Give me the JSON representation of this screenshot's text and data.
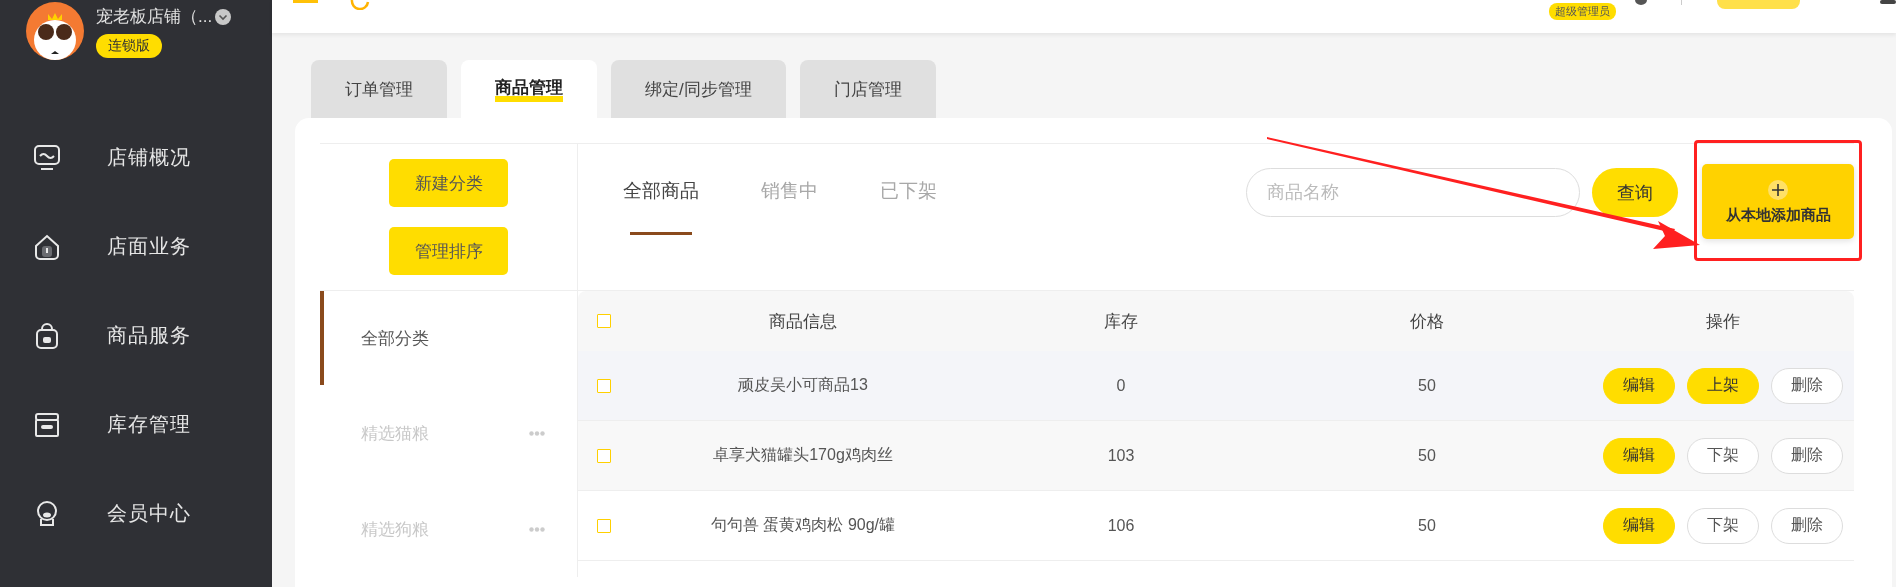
{
  "sidebar": {
    "store_name": "宠老板店铺（...",
    "edition_badge": "连锁版",
    "items": [
      {
        "label": "店铺概况"
      },
      {
        "label": "店面业务"
      },
      {
        "label": "商品服务"
      },
      {
        "label": "库存管理"
      },
      {
        "label": "会员中心"
      }
    ]
  },
  "top_bar": {
    "role_badge": "超级管理员"
  },
  "tabs": [
    {
      "label": "订单管理",
      "selected": false
    },
    {
      "label": "商品管理",
      "selected": true
    },
    {
      "label": "绑定/同步管理",
      "selected": false
    },
    {
      "label": "门店管理",
      "selected": false
    }
  ],
  "categories": {
    "buttons": [
      "新建分类",
      "管理排序"
    ],
    "items": [
      {
        "label": "全部分类",
        "selected": true,
        "has_menu": false
      },
      {
        "label": "精选猫粮",
        "selected": false,
        "has_menu": true
      },
      {
        "label": "精选狗粮",
        "selected": false,
        "has_menu": true
      }
    ]
  },
  "status_tabs": [
    {
      "label": "全部商品",
      "selected": true
    },
    {
      "label": "销售中",
      "selected": false
    },
    {
      "label": "已下架",
      "selected": false
    }
  ],
  "search": {
    "placeholder": "商品名称",
    "button": "查询"
  },
  "add_button": {
    "label": "从本地添加商品"
  },
  "table": {
    "select_all_checked": false,
    "columns": [
      "商品信息",
      "库存",
      "价格",
      "操作"
    ],
    "rows": [
      {
        "checked": false,
        "cells": [
          "顽皮吴小可商品13",
          "0",
          "50"
        ],
        "actions": [
          {
            "label": "编辑",
            "primary": true
          },
          {
            "label": "上架",
            "primary": true
          },
          {
            "label": "删除",
            "primary": false
          }
        ]
      },
      {
        "checked": false,
        "cells": [
          "卓享犬猫罐头170g鸡肉丝",
          "103",
          "50"
        ],
        "actions": [
          {
            "label": "编辑",
            "primary": true
          },
          {
            "label": "下架",
            "primary": false
          },
          {
            "label": "删除",
            "primary": false
          }
        ]
      },
      {
        "checked": false,
        "cells": [
          "句句兽 蛋黄鸡肉松 90g/罐",
          "106",
          "50"
        ],
        "actions": [
          {
            "label": "编辑",
            "primary": true
          },
          {
            "label": "下架",
            "primary": false
          },
          {
            "label": "删除",
            "primary": false
          }
        ]
      }
    ]
  }
}
